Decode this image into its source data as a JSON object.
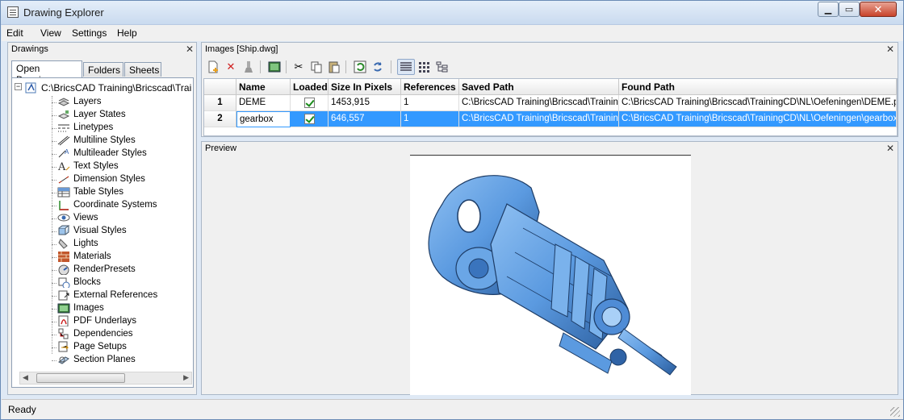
{
  "window": {
    "title": "Drawing Explorer"
  },
  "menu": [
    "Edit",
    "View",
    "Settings",
    "Help"
  ],
  "left_panel": {
    "title": "Drawings",
    "tabs": [
      "Open Drawings",
      "Folders",
      "Sheets"
    ],
    "active_tab": "Open Drawings",
    "root_label": "C:\\BricsCAD Training\\Bricscad\\Trai",
    "items": [
      {
        "label": "Layers",
        "icon": "layers-icon"
      },
      {
        "label": "Layer States",
        "icon": "layer-states-icon"
      },
      {
        "label": "Linetypes",
        "icon": "linetypes-icon"
      },
      {
        "label": "Multiline Styles",
        "icon": "multiline-styles-icon"
      },
      {
        "label": "Multileader Styles",
        "icon": "multileader-styles-icon"
      },
      {
        "label": "Text Styles",
        "icon": "text-styles-icon"
      },
      {
        "label": "Dimension Styles",
        "icon": "dimension-styles-icon"
      },
      {
        "label": "Table Styles",
        "icon": "table-styles-icon"
      },
      {
        "label": "Coordinate Systems",
        "icon": "coordinate-systems-icon"
      },
      {
        "label": "Views",
        "icon": "views-icon"
      },
      {
        "label": "Visual Styles",
        "icon": "visual-styles-icon"
      },
      {
        "label": "Lights",
        "icon": "lights-icon"
      },
      {
        "label": "Materials",
        "icon": "materials-icon"
      },
      {
        "label": "RenderPresets",
        "icon": "render-presets-icon"
      },
      {
        "label": "Blocks",
        "icon": "blocks-icon"
      },
      {
        "label": "External References",
        "icon": "external-references-icon"
      },
      {
        "label": "Images",
        "icon": "images-icon",
        "selected": true
      },
      {
        "label": "PDF Underlays",
        "icon": "pdf-underlays-icon"
      },
      {
        "label": "Dependencies",
        "icon": "dependencies-icon"
      },
      {
        "label": "Page Setups",
        "icon": "page-setups-icon"
      },
      {
        "label": "Section Planes",
        "icon": "section-planes-icon"
      }
    ]
  },
  "images_panel": {
    "title": "Images [Ship.dwg]",
    "columns": [
      "",
      "Name",
      "Loaded",
      "Size In Pixels",
      "References",
      "Saved Path",
      "Found Path"
    ],
    "rows": [
      {
        "num": "1",
        "name": "DEME",
        "loaded": true,
        "size": "1453,915",
        "refs": "1",
        "saved": "C:\\BricsCAD Training\\Bricscad\\TrainingCD",
        "found": "C:\\BricsCAD Training\\Bricscad\\TrainingCD\\NL\\Oefeningen\\DEME.png",
        "selected": false
      },
      {
        "num": "2",
        "name": "gearbox",
        "loaded": true,
        "size": "646,557",
        "refs": "1",
        "saved": "C:\\BricsCAD Training\\Bricscad\\TrainingCD",
        "found": "C:\\BricsCAD Training\\Bricscad\\TrainingCD\\NL\\Oefeningen\\gearbox.png",
        "selected": true
      }
    ]
  },
  "preview_panel": {
    "title": "Preview",
    "image": "gearbox-render-image"
  },
  "status": {
    "text": "Ready"
  },
  "colors": {
    "selection": "#3399ff",
    "part_blue": "#5b9ae0",
    "part_dark": "#1d3c66"
  }
}
